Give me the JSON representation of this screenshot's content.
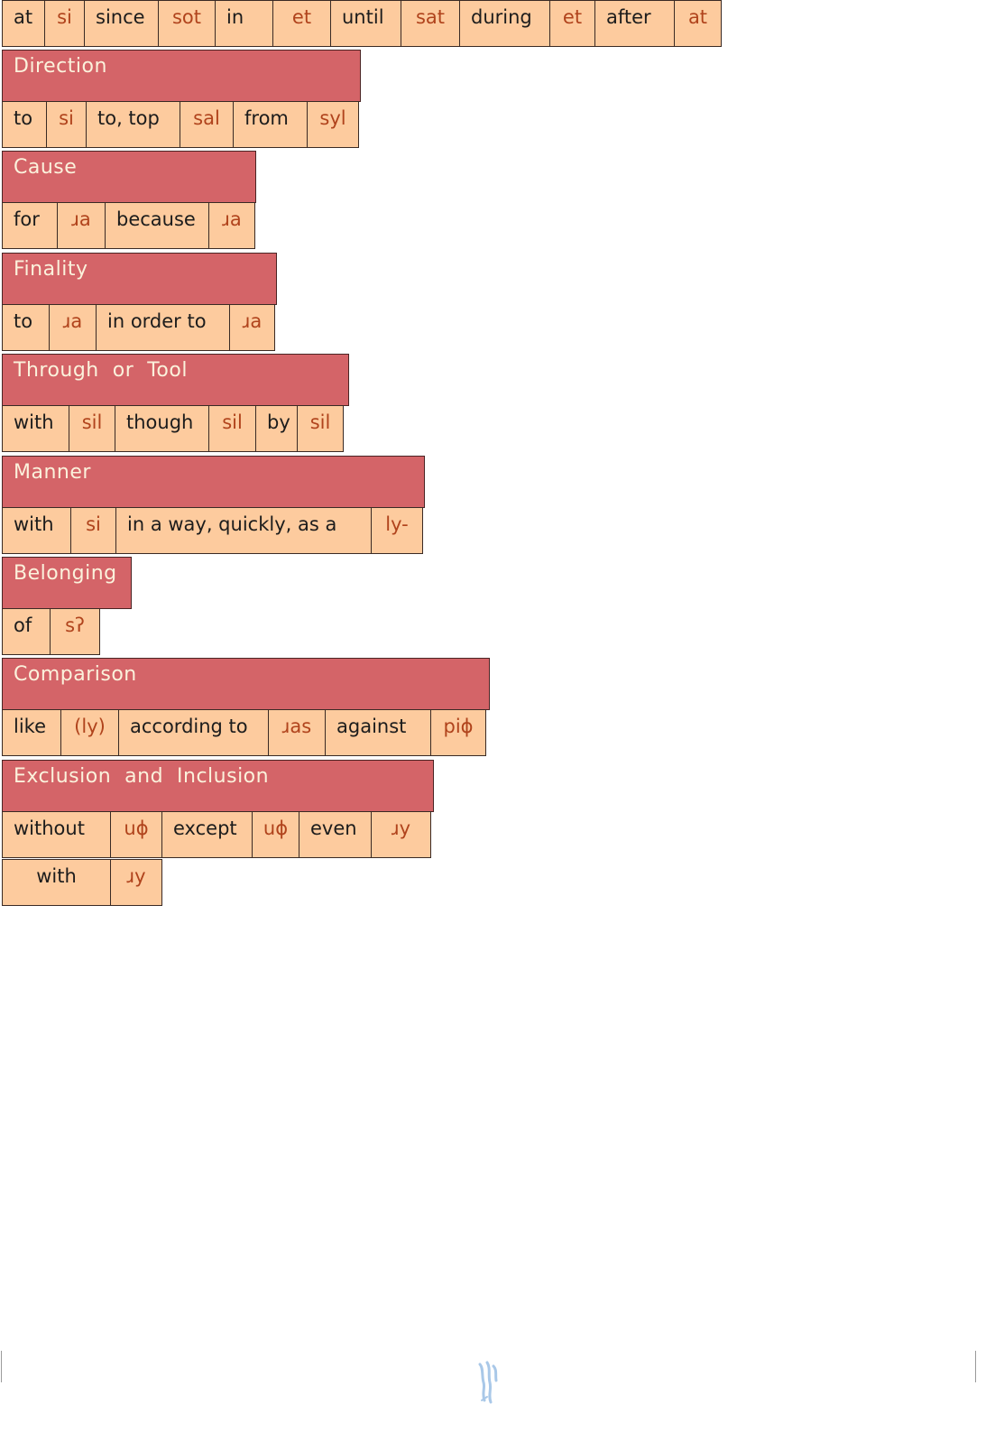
{
  "sections": [
    {
      "title": "",
      "rows": [
        [
          {
            "text": "at",
            "kind": "word"
          },
          {
            "text": "si",
            "kind": "term"
          },
          {
            "text": "since",
            "kind": "word"
          },
          {
            "text": "sot",
            "kind": "term"
          },
          {
            "text": "in",
            "kind": "word"
          },
          {
            "text": "et",
            "kind": "term"
          },
          {
            "text": "until",
            "kind": "word"
          },
          {
            "text": "sat",
            "kind": "term"
          },
          {
            "text": "during",
            "kind": "word"
          },
          {
            "text": "et",
            "kind": "term"
          },
          {
            "text": "after",
            "kind": "word"
          },
          {
            "text": "at",
            "kind": "term"
          }
        ]
      ]
    },
    {
      "title": "Direction",
      "rows": [
        [
          {
            "text": "to",
            "kind": "word"
          },
          {
            "text": "si",
            "kind": "term"
          },
          {
            "text": "to, top",
            "kind": "word"
          },
          {
            "text": "sal",
            "kind": "term"
          },
          {
            "text": "from",
            "kind": "word"
          },
          {
            "text": "syl",
            "kind": "term"
          }
        ]
      ]
    },
    {
      "title": "Cause",
      "rows": [
        [
          {
            "text": "for",
            "kind": "word"
          },
          {
            "text": "ɹa",
            "kind": "term"
          },
          {
            "text": "because",
            "kind": "word"
          },
          {
            "text": "ɹa",
            "kind": "term"
          }
        ]
      ]
    },
    {
      "title": "Finality",
      "rows": [
        [
          {
            "text": "to",
            "kind": "word"
          },
          {
            "text": "ɹa",
            "kind": "term"
          },
          {
            "text": "in order to",
            "kind": "word"
          },
          {
            "text": "ɹa",
            "kind": "term"
          }
        ]
      ]
    },
    {
      "title": "Through  or  Tool",
      "rows": [
        [
          {
            "text": "with",
            "kind": "word"
          },
          {
            "text": "sil",
            "kind": "term"
          },
          {
            "text": "though",
            "kind": "word"
          },
          {
            "text": "sil",
            "kind": "term"
          },
          {
            "text": "by",
            "kind": "word"
          },
          {
            "text": "sil",
            "kind": "term"
          }
        ]
      ]
    },
    {
      "title": "Manner",
      "rows": [
        [
          {
            "text": "with",
            "kind": "word"
          },
          {
            "text": "si",
            "kind": "term"
          },
          {
            "text": "in a way, quickly, as a",
            "kind": "word"
          },
          {
            "text": "ly-",
            "kind": "term"
          }
        ]
      ]
    },
    {
      "title": "Belonging",
      "rows": [
        [
          {
            "text": "of",
            "kind": "word"
          },
          {
            "text": "sʔ",
            "kind": "term"
          }
        ]
      ]
    },
    {
      "title": "Comparison",
      "rows": [
        [
          {
            "text": "like",
            "kind": "word"
          },
          {
            "text": "(ly)",
            "kind": "term"
          },
          {
            "text": "according to",
            "kind": "word"
          },
          {
            "text": "ɹas",
            "kind": "term"
          },
          {
            "text": "against",
            "kind": "word"
          },
          {
            "text": "piɸ",
            "kind": "term"
          }
        ]
      ]
    },
    {
      "title": "Exclusion  and  Inclusion",
      "rows": [
        [
          {
            "text": "without",
            "kind": "word"
          },
          {
            "text": "uɸ",
            "kind": "term"
          },
          {
            "text": "except",
            "kind": "word"
          },
          {
            "text": "uɸ",
            "kind": "term"
          },
          {
            "text": "even",
            "kind": "word"
          },
          {
            "text": "ɹy",
            "kind": "term"
          }
        ],
        [
          {
            "text": "with",
            "kind": "word"
          },
          {
            "text": "ɹy",
            "kind": "term"
          }
        ]
      ]
    }
  ],
  "footer_logo": "script-glyph-logo"
}
